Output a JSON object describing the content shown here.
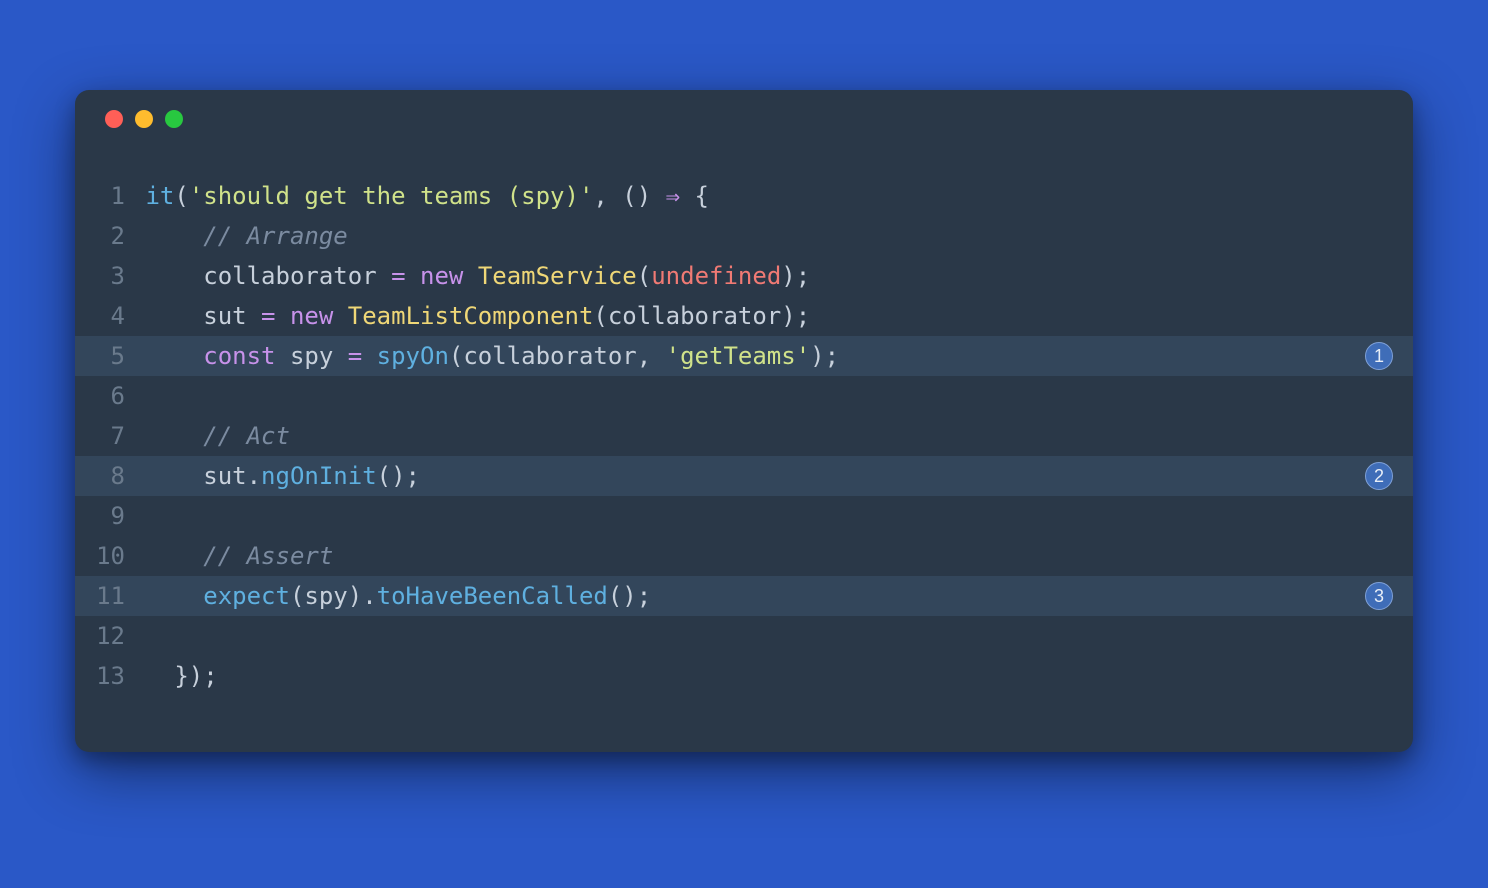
{
  "window": {
    "traffic_lights": [
      "close",
      "minimize",
      "zoom"
    ]
  },
  "code": {
    "lines": [
      {
        "num": "1",
        "highlight": false,
        "annot": null,
        "tokens": [
          {
            "c": "c-fn",
            "t": "it"
          },
          {
            "c": "c-punc",
            "t": "("
          },
          {
            "c": "c-str",
            "t": "'should get the teams (spy)'"
          },
          {
            "c": "c-punc",
            "t": ", () "
          },
          {
            "c": "c-op",
            "t": "⇒"
          },
          {
            "c": "c-punc",
            "t": " {"
          }
        ]
      },
      {
        "num": "2",
        "highlight": false,
        "annot": null,
        "tokens": [
          {
            "c": "c-punc",
            "t": "    "
          },
          {
            "c": "c-comm",
            "t": "// Arrange"
          }
        ]
      },
      {
        "num": "3",
        "highlight": false,
        "annot": null,
        "tokens": [
          {
            "c": "c-punc",
            "t": "    "
          },
          {
            "c": "c-id",
            "t": "collaborator "
          },
          {
            "c": "c-op",
            "t": "="
          },
          {
            "c": "c-punc",
            "t": " "
          },
          {
            "c": "c-kw",
            "t": "new"
          },
          {
            "c": "c-punc",
            "t": " "
          },
          {
            "c": "c-type",
            "t": "TeamService"
          },
          {
            "c": "c-punc",
            "t": "("
          },
          {
            "c": "c-undef",
            "t": "undefined"
          },
          {
            "c": "c-punc",
            "t": ");"
          }
        ]
      },
      {
        "num": "4",
        "highlight": false,
        "annot": null,
        "tokens": [
          {
            "c": "c-punc",
            "t": "    "
          },
          {
            "c": "c-id",
            "t": "sut "
          },
          {
            "c": "c-op",
            "t": "="
          },
          {
            "c": "c-punc",
            "t": " "
          },
          {
            "c": "c-kw",
            "t": "new"
          },
          {
            "c": "c-punc",
            "t": " "
          },
          {
            "c": "c-type",
            "t": "TeamListComponent"
          },
          {
            "c": "c-punc",
            "t": "(collaborator);"
          }
        ]
      },
      {
        "num": "5",
        "highlight": true,
        "annot": "1",
        "tokens": [
          {
            "c": "c-punc",
            "t": "    "
          },
          {
            "c": "c-kw",
            "t": "const"
          },
          {
            "c": "c-punc",
            "t": " spy "
          },
          {
            "c": "c-op",
            "t": "="
          },
          {
            "c": "c-punc",
            "t": " "
          },
          {
            "c": "c-fn",
            "t": "spyOn"
          },
          {
            "c": "c-punc",
            "t": "(collaborator, "
          },
          {
            "c": "c-str",
            "t": "'getTeams'"
          },
          {
            "c": "c-punc",
            "t": ");"
          }
        ]
      },
      {
        "num": "6",
        "highlight": false,
        "annot": null,
        "tokens": []
      },
      {
        "num": "7",
        "highlight": false,
        "annot": null,
        "tokens": [
          {
            "c": "c-punc",
            "t": "    "
          },
          {
            "c": "c-comm",
            "t": "// Act"
          }
        ]
      },
      {
        "num": "8",
        "highlight": true,
        "annot": "2",
        "tokens": [
          {
            "c": "c-punc",
            "t": "    sut."
          },
          {
            "c": "c-fn",
            "t": "ngOnInit"
          },
          {
            "c": "c-punc",
            "t": "();"
          }
        ]
      },
      {
        "num": "9",
        "highlight": false,
        "annot": null,
        "tokens": []
      },
      {
        "num": "10",
        "highlight": false,
        "annot": null,
        "tokens": [
          {
            "c": "c-punc",
            "t": "    "
          },
          {
            "c": "c-comm",
            "t": "// Assert"
          }
        ]
      },
      {
        "num": "11",
        "highlight": true,
        "annot": "3",
        "tokens": [
          {
            "c": "c-punc",
            "t": "    "
          },
          {
            "c": "c-fn",
            "t": "expect"
          },
          {
            "c": "c-punc",
            "t": "(spy)."
          },
          {
            "c": "c-fn",
            "t": "toHaveBeenCalled"
          },
          {
            "c": "c-punc",
            "t": "();"
          }
        ]
      },
      {
        "num": "12",
        "highlight": false,
        "annot": null,
        "tokens": []
      },
      {
        "num": "13",
        "highlight": false,
        "annot": null,
        "tokens": [
          {
            "c": "c-punc",
            "t": "  });"
          }
        ]
      }
    ]
  }
}
